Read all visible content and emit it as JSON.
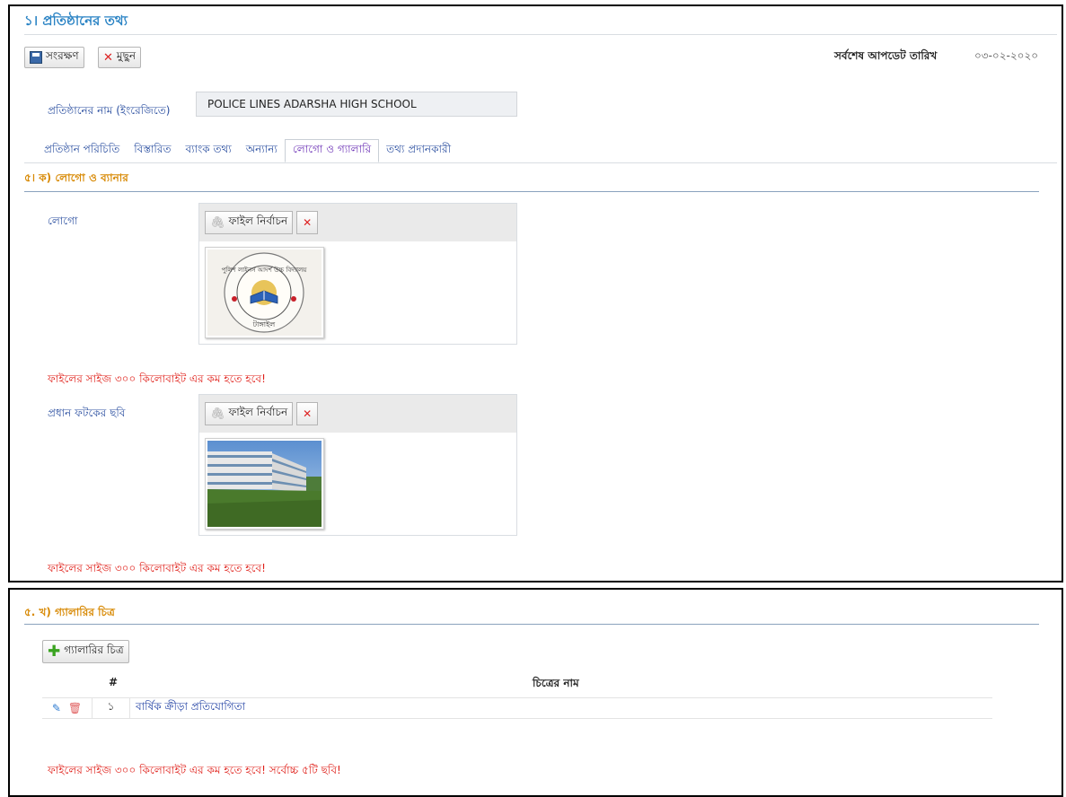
{
  "section": {
    "title": "১। প্রতিষ্ঠানের তথ্য"
  },
  "toolbar": {
    "save_label": "সংরক্ষণ",
    "delete_label": "মুছুন"
  },
  "last_update": {
    "label": "সর্বশেষ আপডেট তারিখ",
    "value": "০৩-০২-২০২০"
  },
  "institution": {
    "name_label": "প্রতিষ্ঠানের নাম (ইংরেজিতে)",
    "name_value": "POLICE LINES ADARSHA HIGH SCHOOL"
  },
  "tabs": [
    {
      "label": "প্রতিষ্ঠান পরিচিতি"
    },
    {
      "label": "বিস্তারিত"
    },
    {
      "label": "ব্যাংক তথ্য"
    },
    {
      "label": "অন্যান্য"
    },
    {
      "label": "লোগো ও গ্যালারি",
      "active": true
    },
    {
      "label": "তথ্য প্রদানকারী"
    }
  ],
  "logo_section": {
    "title": "৫। ক) লোগো ও ব্যানার",
    "logo_label": "লোগো",
    "gate_label": "প্রধান ফটকের ছবি",
    "file_button": "ফাইল নির্বাচন",
    "size_warning": "ফাইলের সাইজ ৩০০ কিলোবাইট এর কম হতে হবে!"
  },
  "gallery_section": {
    "title": "৫. খ) গ্যালারির চিত্র",
    "add_button": "গ্যালারির চিত্র",
    "col_hash": "#",
    "col_name": "চিত্রের নাম",
    "rows": [
      {
        "index": "১",
        "name": "বার্ষিক ক্রীড়া প্রতিযোগিতা"
      }
    ],
    "warning": "ফাইলের সাইজ ৩০০ কিলোবাইট এর কম হতে হবে! সর্বোচ্চ ৫টি ছবি!"
  },
  "logo_image": {
    "ring_text": "পুলিশ লাইনস আদর্শ উচ্চ বিদ্যালয়",
    "bottom_text": "টাঙ্গাইল"
  },
  "colors": {
    "accent": "#2a83c4",
    "section_orange": "#d88a06",
    "warning_red": "#e0201a",
    "link_blue": "#2b4fa0",
    "active_tab": "#6a2fb5"
  }
}
